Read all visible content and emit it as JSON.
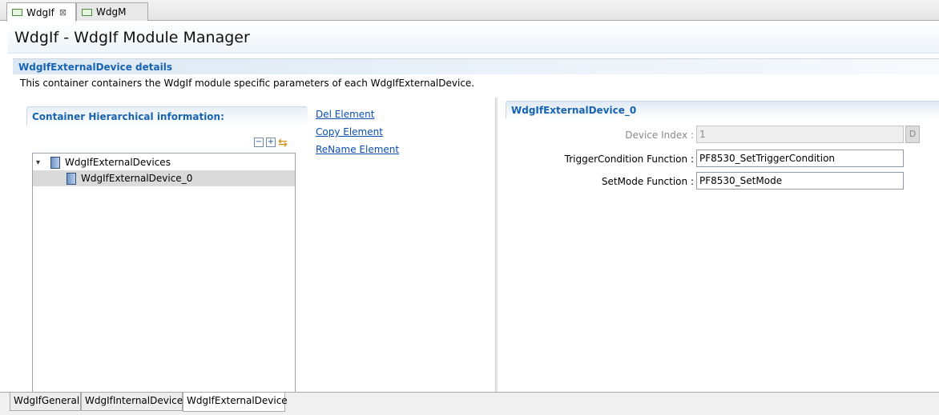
{
  "editor_tabs": [
    {
      "label": "WdgIf",
      "active": true,
      "close": "⊠"
    },
    {
      "label": "WdgM",
      "active": false
    }
  ],
  "header": {
    "title": "WdgIf - WdgIf Module Manager"
  },
  "section": {
    "title": "WdgIfExternalDevice details",
    "description": "This container containers the WdgIf module specific parameters of each WdgIfExternalDevice."
  },
  "hierarchy": {
    "title": "Container Hierarchical information:",
    "tools": {
      "collapse": "−",
      "expand": "+",
      "sync": "⇆"
    },
    "tree": {
      "root": {
        "label": "WdgIfExternalDevices",
        "twisty": "▾"
      },
      "child": {
        "label": "WdgIfExternalDevice_0",
        "selected": true
      }
    }
  },
  "actions": {
    "del": "Del Element",
    "copy": "Copy Element",
    "rename": "ReName Element"
  },
  "details": {
    "title": "WdgIfExternalDevice_0",
    "device_index": {
      "label": "Device Index :",
      "value": "1",
      "button": "D"
    },
    "trigger_condition": {
      "label": "TriggerCondition Function :",
      "value": "PF8530_SetTriggerCondition"
    },
    "set_mode": {
      "label": "SetMode Function :",
      "value": "PF8530_SetMode"
    }
  },
  "bottom_tabs": [
    {
      "label": "WdgIfGeneral",
      "active": false
    },
    {
      "label": "WdgIfInternalDevice",
      "active": false
    },
    {
      "label": "WdgIfExternalDevice",
      "active": true
    }
  ],
  "colors": {
    "accent": "#1763b3",
    "link": "#0b4fb0",
    "selection": "#dadada"
  }
}
